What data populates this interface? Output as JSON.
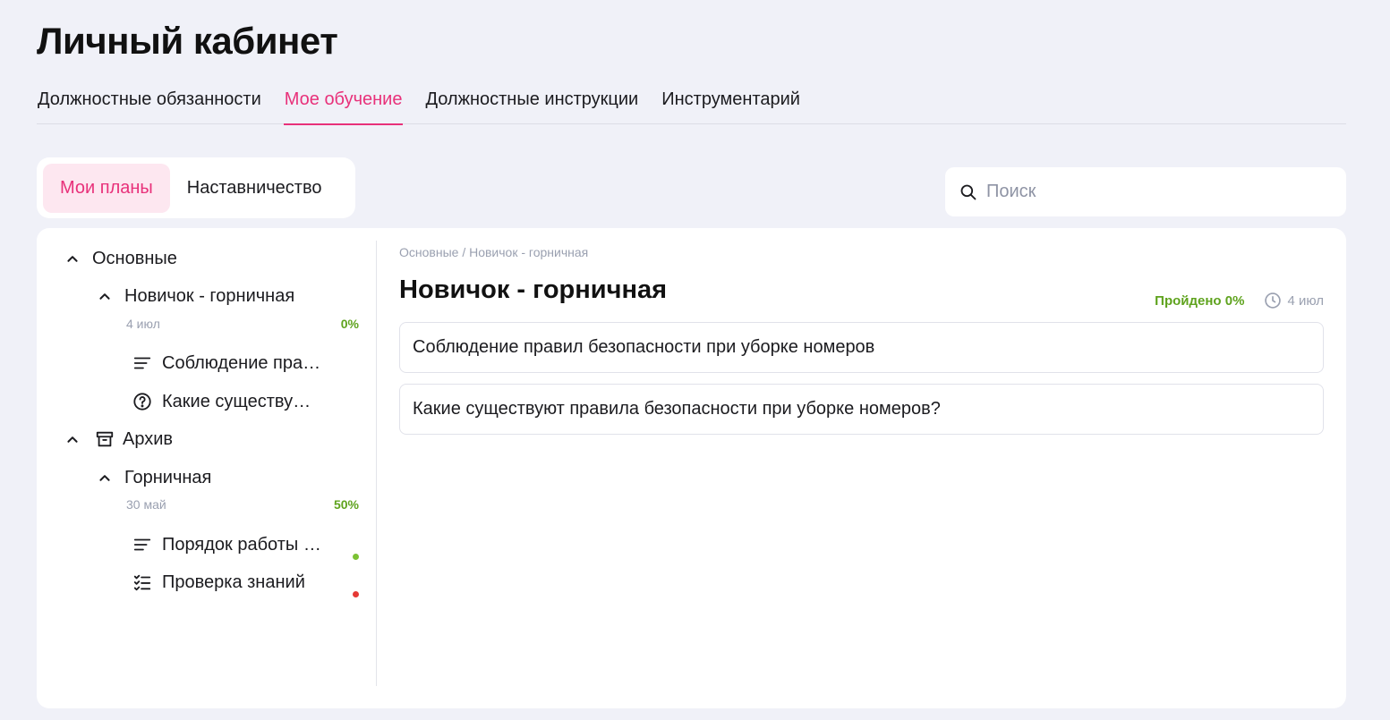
{
  "header": {
    "title": "Личный кабинет"
  },
  "top_tabs": [
    {
      "label": "Должностные обязанности",
      "active": false
    },
    {
      "label": "Мое обучение",
      "active": true
    },
    {
      "label": "Должностные инструкции",
      "active": false
    },
    {
      "label": "Инструментарий",
      "active": false
    }
  ],
  "sub_tabs": [
    {
      "label": "Мои планы",
      "active": true
    },
    {
      "label": "Наставничество",
      "active": false
    }
  ],
  "search": {
    "placeholder": "Поиск",
    "value": ""
  },
  "sidebar": {
    "groups": [
      {
        "label": "Основные",
        "plan": {
          "label": "Новичок - горничная",
          "date": "4 июл",
          "progress": "0%",
          "items": [
            {
              "label": "Соблюдение правил безопасности при уборке номеров",
              "icon": "lines-icon"
            },
            {
              "label": "Какие существуют правила безопасности при уборке номеров?",
              "icon": "question-icon"
            }
          ]
        }
      },
      {
        "label": "Архив",
        "icon": "archive-icon",
        "plan": {
          "label": "Горничная",
          "date": "30 май",
          "progress": "50%",
          "items": [
            {
              "label": "Порядок работы горничной",
              "icon": "lines-icon",
              "status_color": "#7cc234"
            },
            {
              "label": "Проверка знаний",
              "icon": "checklist-icon",
              "status_color": "#e53935"
            }
          ]
        }
      }
    ]
  },
  "content": {
    "breadcrumb": "Основные / Новичок - горничная",
    "title": "Новичок - горничная",
    "passed": "Пройдено 0%",
    "date": "4 июл",
    "items": [
      {
        "label": "Соблюдение правил безопасности при уборке номеров"
      },
      {
        "label": "Какие существуют правила безопасности при уборке номеров?"
      }
    ]
  },
  "colors": {
    "accent": "#e8317a",
    "accent_bg": "#fde7f0",
    "success": "#5fa31e",
    "background": "#f0f1f8"
  }
}
